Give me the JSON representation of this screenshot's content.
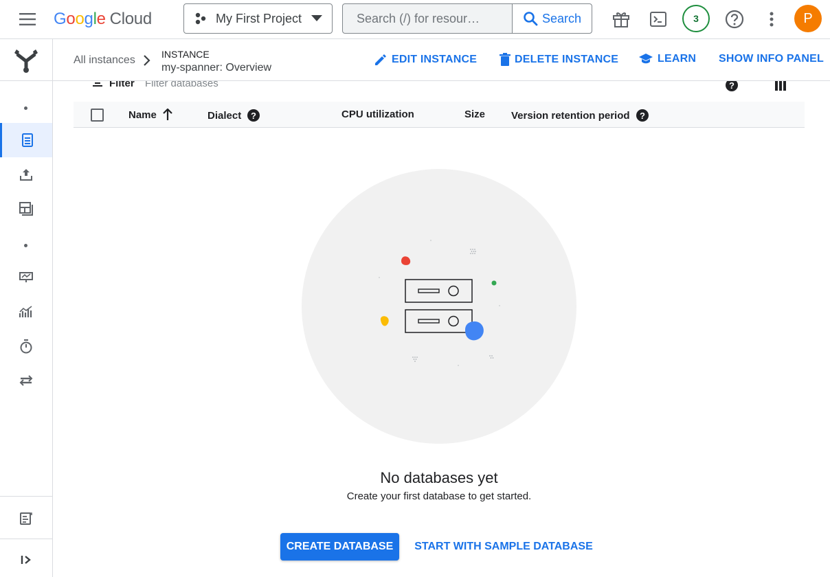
{
  "header": {
    "logo_word": [
      "G",
      "o",
      "o",
      "g",
      "l",
      "e"
    ],
    "logo_colors": [
      "#4285F4",
      "#EA4335",
      "#FBBC05",
      "#4285F4",
      "#34A853",
      "#EA4335"
    ],
    "logo_product": "Cloud",
    "project_name": "My First Project",
    "search_placeholder": "Search (/) for resour…",
    "search_label": "Search",
    "notification_count": "3",
    "avatar_letter": "P"
  },
  "breadcrumb": {
    "all_instances": "All instances",
    "kind": "INSTANCE",
    "title": "my-spanner: Overview"
  },
  "actions": {
    "edit": "EDIT INSTANCE",
    "delete": "DELETE INSTANCE",
    "learn": "LEARN",
    "info": "SHOW INFO PANEL"
  },
  "filter": {
    "label": "Filter",
    "placeholder": "Filter databases"
  },
  "table": {
    "columns": [
      "Name",
      "Dialect",
      "CPU utilization",
      "Size",
      "Version retention period"
    ]
  },
  "empty_state": {
    "title": "No databases yet",
    "subtitle": "Create your first database to get started.",
    "primary_button": "CREATE DATABASE",
    "secondary_button": "START WITH SAMPLE DATABASE"
  },
  "colors": {
    "accent": "#1a73e8",
    "avatar": "#f57c00",
    "notification_ring": "#1e8e3e"
  }
}
